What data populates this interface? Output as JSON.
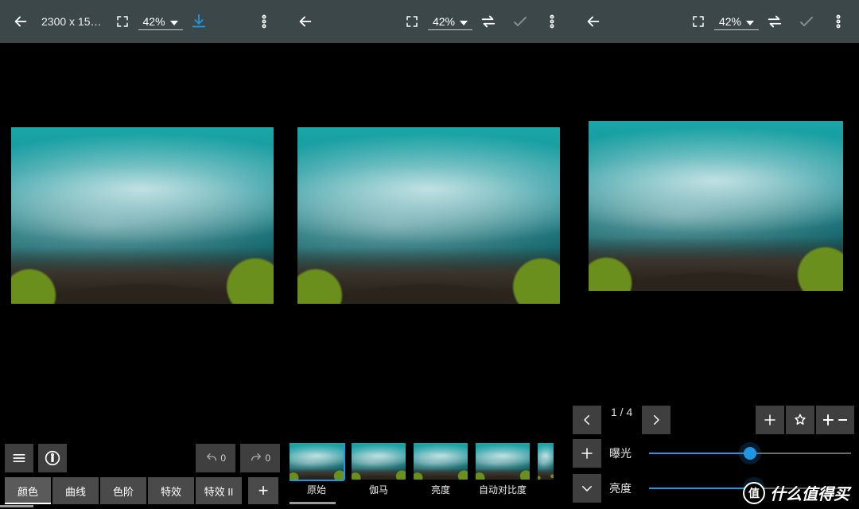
{
  "panel0": {
    "dimensions": "2300 x 15…",
    "zoom": "42%",
    "undo_count": "0",
    "redo_count": "0",
    "tabs": [
      "颜色",
      "曲线",
      "色阶",
      "特效",
      "特效 II"
    ],
    "active_tab": 0,
    "add": "+"
  },
  "panel1": {
    "zoom": "42%",
    "presets": [
      "原始",
      "伽马",
      "亮度",
      "自动对比度"
    ]
  },
  "panel2": {
    "zoom": "42%",
    "nav_counter": "1 / 4",
    "rows": [
      {
        "label": "曝光",
        "pos": 0.5
      },
      {
        "label": "亮度",
        "pos": 0.52
      }
    ]
  },
  "watermark": {
    "badge": "值",
    "text": "什么值得买"
  }
}
